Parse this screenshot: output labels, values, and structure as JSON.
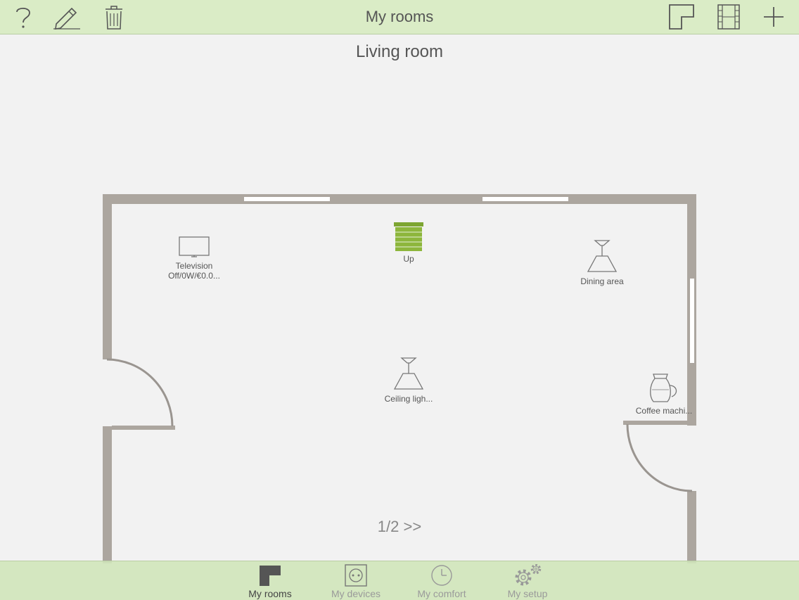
{
  "header": {
    "title": "My rooms",
    "left_icons": [
      "help-icon",
      "edit-icon",
      "trash-icon"
    ],
    "right_icons": [
      "floorplan-icon",
      "film-icon",
      "add-icon"
    ]
  },
  "room": {
    "name": "Living room"
  },
  "devices": [
    {
      "name": "Television",
      "status": "Off/0W/€0.0...",
      "icon": "television-icon"
    },
    {
      "name": "Up",
      "icon": "blind-icon",
      "color": "#8db63c"
    },
    {
      "name": "Dining area",
      "icon": "ceiling-lamp-icon"
    },
    {
      "name": "Ceiling ligh...",
      "icon": "ceiling-lamp-icon"
    },
    {
      "name": "Coffee machi...",
      "icon": "coffee-machine-icon"
    }
  ],
  "pager": "1/2 >>",
  "tabs": [
    {
      "label": "My rooms",
      "icon": "rooms-icon",
      "active": true
    },
    {
      "label": "My devices",
      "icon": "socket-icon"
    },
    {
      "label": "My comfort",
      "icon": "clock-icon"
    },
    {
      "label": "My setup",
      "icon": "gear-icon"
    }
  ],
  "colors": {
    "topbar": "#daecc6",
    "bottombar": "#d0e6ba",
    "wall": "#aca69f",
    "accent": "#8db63c",
    "background": "#f2f2f2"
  }
}
